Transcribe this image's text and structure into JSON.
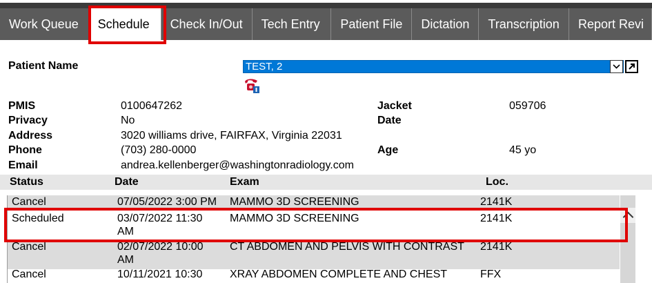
{
  "tabs": [
    {
      "label": "Work Queue",
      "active": false,
      "w": "w-workqueue"
    },
    {
      "label": "Schedule",
      "active": true,
      "w": "w-schedule"
    },
    {
      "label": "Check In/Out",
      "active": false,
      "w": "w-checkinout"
    },
    {
      "label": "Tech Entry",
      "active": false,
      "w": "w-techentry"
    },
    {
      "label": "Patient File",
      "active": false,
      "w": "w-patientfile"
    },
    {
      "label": "Dictation",
      "active": false,
      "w": "w-dictation"
    },
    {
      "label": "Transcription",
      "active": false,
      "w": "w-transcription"
    },
    {
      "label": "Report Revi",
      "active": false,
      "w": "w-report"
    }
  ],
  "patient": {
    "name_label": "Patient Name",
    "name_value": "TEST, 2",
    "pmis_label": "PMIS",
    "pmis_value": "0100647262",
    "privacy_label": "Privacy",
    "privacy_value": "No",
    "address_label": "Address",
    "address_value": "3020 williams drive, FAIRFAX, Virginia 22031",
    "phone_label": "Phone",
    "phone_value": "(703) 280-0000",
    "email_label": "Email",
    "email_value": "andrea.kellenberger@washingtonradiology.com",
    "jacket_label": "Jacket",
    "jacket_value": "059706",
    "date_label": "Date",
    "age_label": "Age",
    "age_value": "45 yo"
  },
  "table": {
    "headers": {
      "status": "Status",
      "date": "Date",
      "exam": "Exam",
      "loc": "Loc."
    },
    "rows": [
      {
        "status": "Cancel",
        "date": "07/05/2022 3:00 PM",
        "exam": "MAMMO 3D SCREENING",
        "loc": "2141K",
        "shaded": true
      },
      {
        "status": "Scheduled",
        "date": "03/07/2022 11:30 AM",
        "exam": "MAMMO 3D SCREENING",
        "loc": "2141K",
        "shaded": false
      },
      {
        "status": "Cancel",
        "date": "02/07/2022 10:00 AM",
        "exam": "CT ABDOMEN AND PELVIS WITH CONTRAST",
        "loc": "2141K",
        "shaded": true
      },
      {
        "status": "Cancel",
        "date": "10/11/2021 10:30",
        "exam": "XRAY ABDOMEN COMPLETE AND CHEST",
        "loc": "FFX",
        "shaded": false
      }
    ]
  },
  "colors": {
    "highlight": "#e00000",
    "select_bg": "#0078d7",
    "tabbar_bg": "#5b5b5b"
  },
  "icons": {
    "phone": "phone-info-icon",
    "popout": "popout-icon",
    "dropdown": "chevron-down-icon",
    "scroll_up": "chevron-up-icon"
  }
}
